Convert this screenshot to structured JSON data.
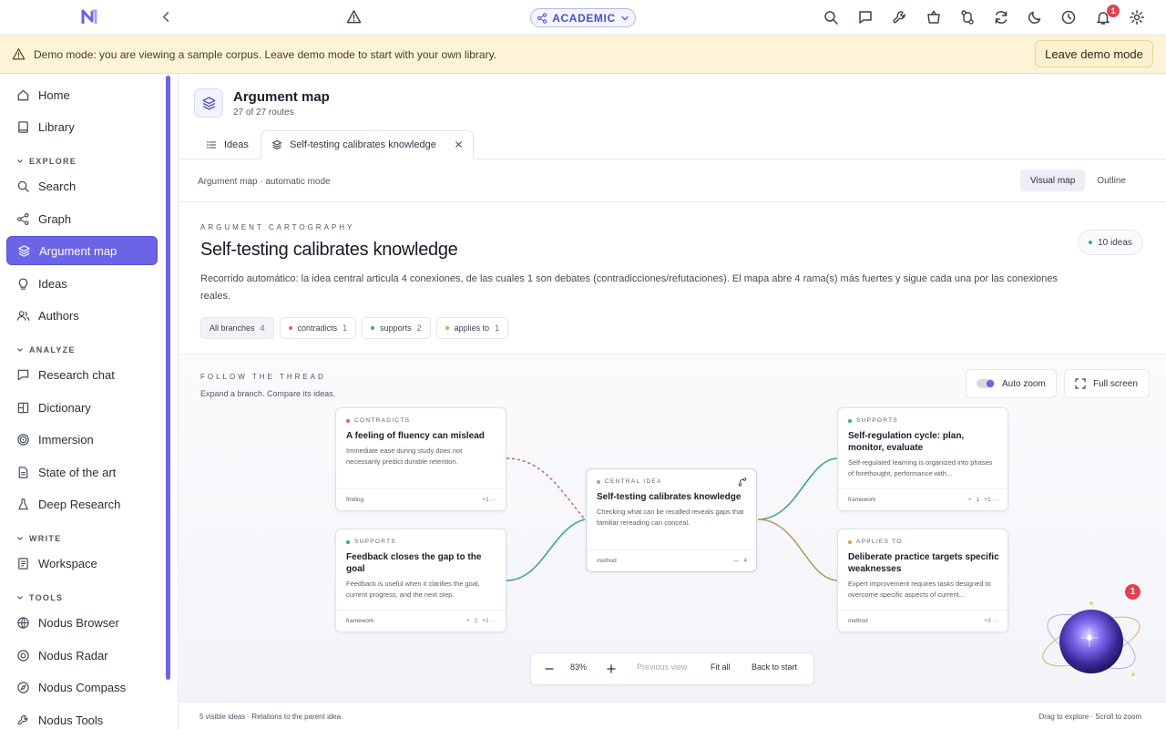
{
  "topbar": {
    "mode_label": "ACADEMIC",
    "notifications_count": "1",
    "brand_color": "#5a5fd0"
  },
  "banner": {
    "text": "Demo mode: you are viewing a sample corpus. Leave demo mode to start with your own library.",
    "button_label": "Leave demo mode"
  },
  "sidebar": {
    "items": [
      {
        "label": "Home",
        "icon": "home-icon"
      },
      {
        "label": "Library",
        "icon": "book-icon"
      },
      {
        "label": "Search",
        "icon": "search-icon"
      },
      {
        "label": "Graph",
        "icon": "graph-icon"
      },
      {
        "label": "Argument map",
        "icon": "layers-icon"
      },
      {
        "label": "Ideas",
        "icon": "lightbulb-icon"
      },
      {
        "label": "Authors",
        "icon": "users-icon"
      },
      {
        "label": "Research chat",
        "icon": "chat-icon"
      },
      {
        "label": "Dictionary",
        "icon": "dictionary-icon"
      },
      {
        "label": "Immersion",
        "icon": "target-icon"
      },
      {
        "label": "State of the art",
        "icon": "document-icon"
      },
      {
        "label": "Deep Research",
        "icon": "flask-icon"
      },
      {
        "label": "Workspace",
        "icon": "workspace-icon"
      },
      {
        "label": "Nodus Browser",
        "icon": "globe-icon"
      },
      {
        "label": "Nodus Radar",
        "icon": "radar-icon"
      },
      {
        "label": "Nodus Compass",
        "icon": "compass-icon"
      },
      {
        "label": "Nodus Tools",
        "icon": "wrench-icon"
      }
    ],
    "sections": {
      "explore": "EXPLORE",
      "analyze": "ANALYZE",
      "write": "WRITE",
      "tools": "TOOLS"
    }
  },
  "header": {
    "title": "Argument map",
    "subtitle": "27 of 27 routes"
  },
  "tabs": [
    {
      "label": "Ideas"
    },
    {
      "label": "Self-testing calibrates knowledge"
    }
  ],
  "mode_bar": {
    "label": "Argument map · automatic mode",
    "views": [
      "Visual map",
      "Outline"
    ]
  },
  "overview": {
    "eyebrow": "ARGUMENT CARTOGRAPHY",
    "title": "Self-testing calibrates knowledge",
    "description": "Recorrido automático: la idea central articula 4 conexiones, de las cuales 1 son debates (contradicciones/refutaciones). El mapa abre 4 rama(s) más fuertes y sigue cada una por las conexiones reales.",
    "ideas_count": "10 ideas",
    "filters": [
      {
        "label": "All branches",
        "count": "4",
        "color": ""
      },
      {
        "label": "contradicts",
        "count": "1",
        "color": "#e0607a"
      },
      {
        "label": "supports",
        "count": "2",
        "color": "#3aa88a"
      },
      {
        "label": "applies to",
        "count": "1",
        "color": "#d9a246"
      }
    ]
  },
  "thread": {
    "eyebrow": "FOLLOW THE THREAD",
    "hint": "Expand a branch. Compare its ideas.",
    "auto_zoom": "Auto zoom",
    "full_screen": "Full screen"
  },
  "cards": {
    "central": {
      "kind": "CENTRAL IDEA",
      "title": "Self-testing calibrates knowledge",
      "body": "Checking what can be recalled reveals gaps that familiar rereading can conceal.",
      "type": "method",
      "meta": "4"
    },
    "c1": {
      "kind": "CONTRADICTS",
      "title": "A feeling of fluency can mislead",
      "body": "Immediate ease during study does not necessarily predict durable retention.",
      "type": "finding",
      "meta": "+1 ···",
      "color": "#e0607a"
    },
    "c2": {
      "kind": "SUPPORTS",
      "title": "Feedback closes the gap to the goal",
      "body": "Feedback is useful when it clarifies the goal, current progress, and the next step.",
      "type": "framework",
      "plus": "2",
      "meta": "+1 ···",
      "color": "#3aa88a"
    },
    "c3": {
      "kind": "SUPPORTS",
      "title": "Self-regulation cycle: plan, monitor, evaluate",
      "body": "Self-regulated learning is organized into phases of forethought, performance with...",
      "type": "framework",
      "plus": "1",
      "meta": "+1 ···",
      "color": "#3aa88a"
    },
    "c4": {
      "kind": "APPLIES TO",
      "title": "Deliberate practice targets specific weaknesses",
      "body": "Expert improvement requires tasks designed to overcome specific aspects of current...",
      "type": "method",
      "meta": "+3 ···",
      "color": "#d9a246"
    }
  },
  "zoom": {
    "level": "83%",
    "previous": "Previous view",
    "fit": "Fit all",
    "back": "Back to start"
  },
  "status": {
    "left": "5 visible ideas · Relations to the parent idea",
    "right": "Drag to explore · Scroll to zoom"
  },
  "assistant": {
    "badge": "1"
  }
}
